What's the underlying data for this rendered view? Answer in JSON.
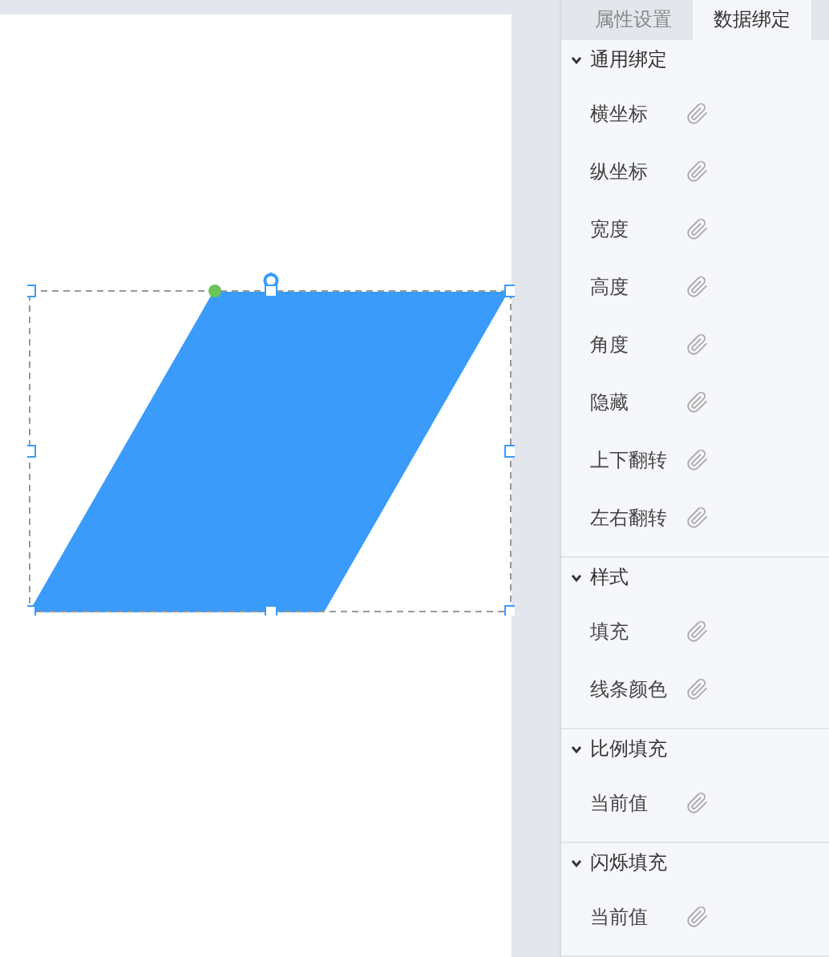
{
  "canvas": {
    "shape": {
      "kind": "parallelogram",
      "selected": true
    }
  },
  "tabs": [
    {
      "label": "属性设置",
      "selected": false
    },
    {
      "label": "数据绑定",
      "selected": true
    }
  ],
  "sections": [
    {
      "title": "通用绑定",
      "expanded": true,
      "items": [
        "横坐标",
        "纵坐标",
        "宽度",
        "高度",
        "角度",
        "隐藏",
        "上下翻转",
        "左右翻转"
      ]
    },
    {
      "title": "样式",
      "expanded": true,
      "items": [
        "填充",
        "线条颜色"
      ]
    },
    {
      "title": "比例填充",
      "expanded": true,
      "items": [
        "当前值"
      ]
    },
    {
      "title": "闪烁填充",
      "expanded": true,
      "items": [
        "当前值"
      ]
    }
  ]
}
